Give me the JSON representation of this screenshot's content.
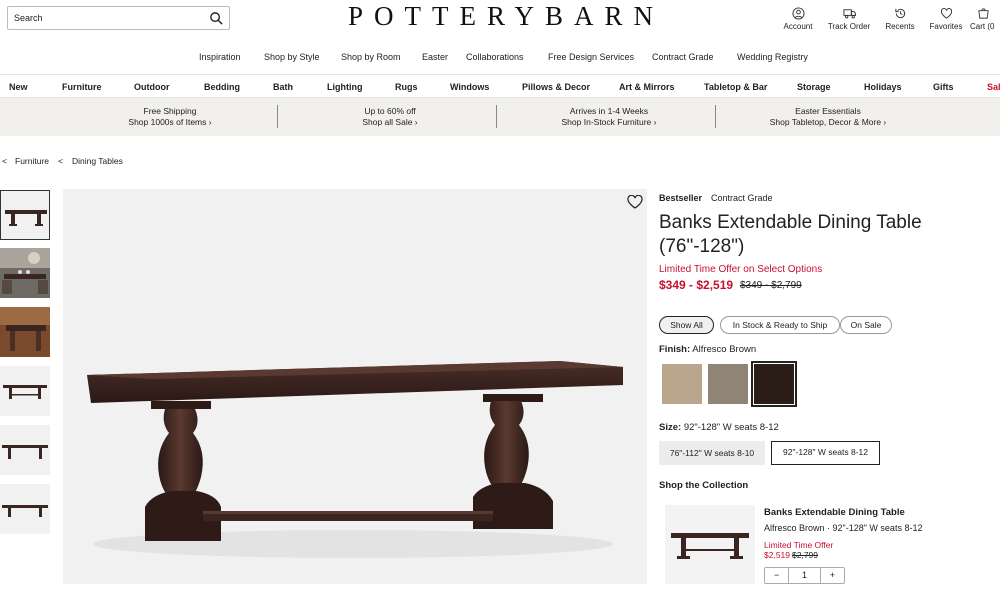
{
  "search": {
    "placeholder": "Search"
  },
  "brand": {
    "logo_text": "POTTERYBARN"
  },
  "utility": [
    {
      "label": "Account",
      "icon": "account-icon"
    },
    {
      "label": "Track Order",
      "icon": "truck-icon"
    },
    {
      "label": "Recents",
      "icon": "recents-icon"
    },
    {
      "label": "Favorites",
      "icon": "heart-icon"
    },
    {
      "label": "Cart (0",
      "icon": "cart-icon"
    }
  ],
  "subnav": [
    "Inspiration",
    "Shop by Style",
    "Shop by Room",
    "Easter",
    "Collaborations",
    "Free Design Services",
    "Contract Grade",
    "Wedding Registry"
  ],
  "mainnav": [
    "New",
    "Furniture",
    "Outdoor",
    "Bedding",
    "Bath",
    "Lighting",
    "Rugs",
    "Windows",
    "Pillows & Decor",
    "Art & Mirrors",
    "Tabletop & Bar",
    "Storage",
    "Holidays",
    "Gifts",
    "Sal"
  ],
  "promos": [
    {
      "title": "Free Shipping",
      "sub": "Shop 1000s of Items ›"
    },
    {
      "title": "Up to 60% off",
      "sub": "Shop all Sale ›"
    },
    {
      "title": "Arrives in 1-4 Weeks",
      "sub": "Shop In-Stock Furniture ›"
    },
    {
      "title": "Easter Essentials",
      "sub": "Shop Tabletop, Decor & More ›"
    }
  ],
  "breadcrumb": {
    "sep": "<",
    "items": [
      "Furniture",
      "Dining Tables"
    ]
  },
  "product": {
    "tags": [
      "Bestseller",
      "Contract Grade"
    ],
    "title": "Banks Extendable Dining Table (76\"-128\")",
    "offer": "Limited Time Offer on Select Options",
    "price": "$349 - $2,519",
    "was_price": "$349 - $2,799",
    "filters": [
      "Show All",
      "In Stock & Ready to Ship",
      "On Sale"
    ],
    "finish_label": "Finish:",
    "finish_value": "Alfresco Brown",
    "swatch_colors": [
      "#b9a68c",
      "#8f8476",
      "#2a1c16"
    ],
    "size_label": "Size:",
    "size_value": "92\"-128\" W seats 8-12",
    "sizes": [
      "76\"-112\" W seats 8-10",
      "92\"-128\" W seats 8-12"
    ]
  },
  "collection": {
    "heading": "Shop the Collection",
    "item_title": "Banks Extendable Dining Table",
    "item_finish": "Alfresco Brown · 92\"-128\" W seats 8-12",
    "item_offer": "Limited Time Offer",
    "item_price": "$2,519",
    "item_was": "$2,799",
    "qty_minus": "−",
    "qty_value": "1",
    "qty_plus": "+"
  },
  "colors": {
    "sale_red": "#c8102e",
    "wood": "#3a2520"
  }
}
